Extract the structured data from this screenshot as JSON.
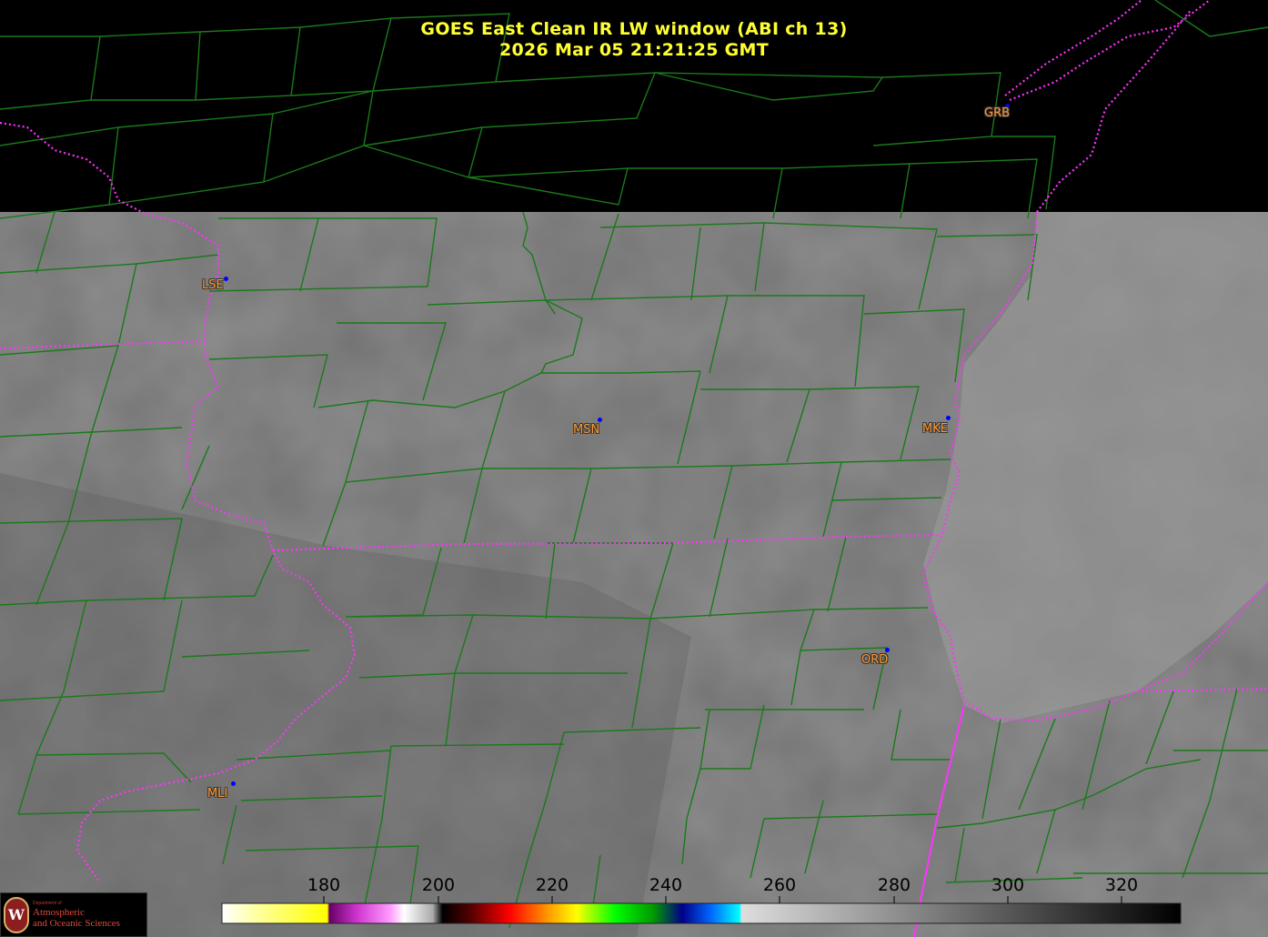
{
  "title": {
    "line1": "GOES East Clean IR LW window (ABI ch 13)",
    "line2": "2026 Mar 05  21:21:25 GMT"
  },
  "stations": [
    {
      "id": "GRB"
    },
    {
      "id": "LSE"
    },
    {
      "id": "MSN"
    },
    {
      "id": "MKE"
    },
    {
      "id": "ORD"
    },
    {
      "id": "MLI"
    }
  ],
  "colorbar": {
    "ticks": [
      "180",
      "200",
      "220",
      "240",
      "260",
      "280",
      "300",
      "320"
    ]
  },
  "logo": {
    "small": "Department of",
    "line1": "Atmospheric",
    "line2": "and Oceanic Sciences",
    "seal_letter": "W"
  },
  "colors": {
    "title": "#ffff33",
    "station_label": "#ff9933",
    "county_lines": "#1a7a1a",
    "state_lines": "#ff33ff",
    "background_missing": "#000000"
  }
}
